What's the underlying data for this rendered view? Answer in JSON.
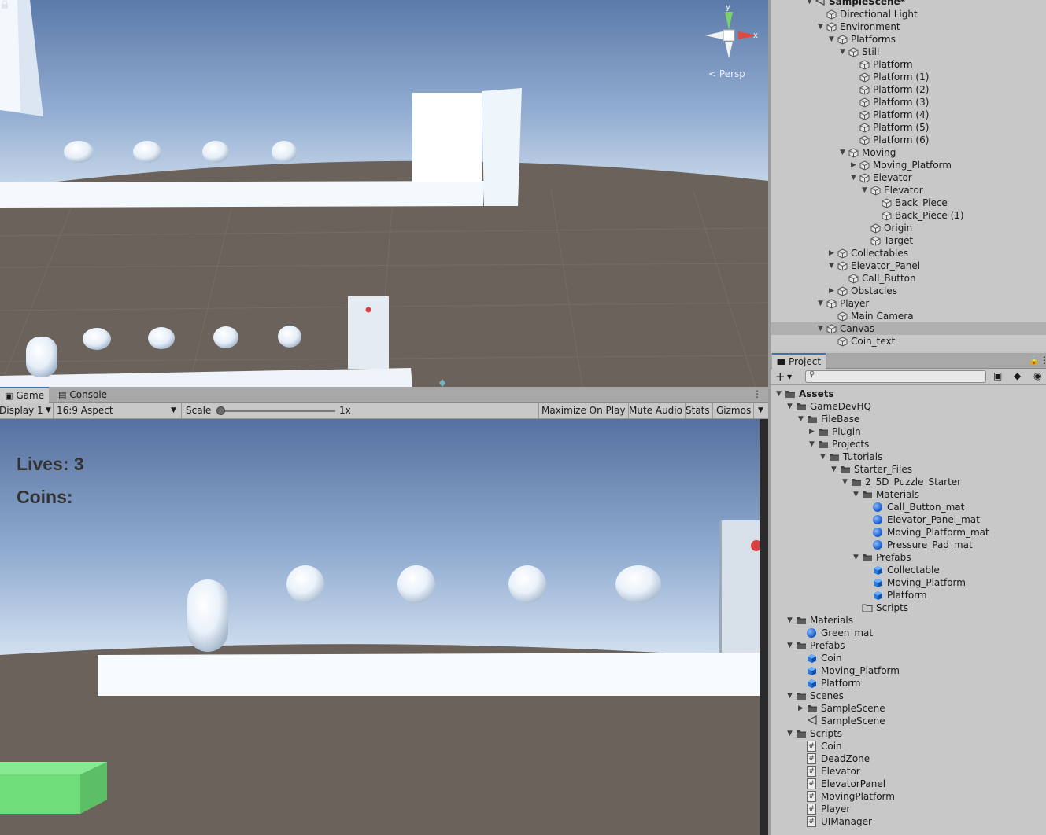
{
  "scene_view": {
    "projection_label": "< Persp",
    "gizmo_axes": {
      "y": "y",
      "x": "x"
    }
  },
  "game_panel": {
    "tabs": [
      {
        "label": "Game",
        "icon": "gamepad-icon",
        "active": true
      },
      {
        "label": "Console",
        "icon": "console-icon",
        "active": false
      }
    ],
    "toolbar": {
      "display": "Display 1",
      "aspect": "16:9 Aspect",
      "scale_label": "Scale",
      "scale_value": "1x",
      "maximize": "Maximize On Play",
      "mute": "Mute Audio",
      "stats": "Stats",
      "gizmos": "Gizmos"
    },
    "hud": {
      "lives": "Lives: 3",
      "coins": "Coins:"
    }
  },
  "hierarchy": {
    "items": [
      {
        "label": "SampleScene*",
        "depth": 2,
        "arrow": "down",
        "type": "scene"
      },
      {
        "label": "Directional Light",
        "depth": 3,
        "arrow": "",
        "type": "object"
      },
      {
        "label": "Environment",
        "depth": 3,
        "arrow": "down",
        "type": "object"
      },
      {
        "label": "Platforms",
        "depth": 4,
        "arrow": "down",
        "type": "object"
      },
      {
        "label": "Still",
        "depth": 5,
        "arrow": "down",
        "type": "object"
      },
      {
        "label": "Platform",
        "depth": 6,
        "arrow": "",
        "type": "object"
      },
      {
        "label": "Platform (1)",
        "depth": 6,
        "arrow": "",
        "type": "object"
      },
      {
        "label": "Platform (2)",
        "depth": 6,
        "arrow": "",
        "type": "object"
      },
      {
        "label": "Platform (3)",
        "depth": 6,
        "arrow": "",
        "type": "object"
      },
      {
        "label": "Platform (4)",
        "depth": 6,
        "arrow": "",
        "type": "object"
      },
      {
        "label": "Platform (5)",
        "depth": 6,
        "arrow": "",
        "type": "object"
      },
      {
        "label": "Platform (6)",
        "depth": 6,
        "arrow": "",
        "type": "object"
      },
      {
        "label": "Moving",
        "depth": 5,
        "arrow": "down",
        "type": "object"
      },
      {
        "label": "Moving_Platform",
        "depth": 6,
        "arrow": "right",
        "type": "object"
      },
      {
        "label": "Elevator",
        "depth": 6,
        "arrow": "down",
        "type": "object"
      },
      {
        "label": "Elevator",
        "depth": 7,
        "arrow": "down",
        "type": "object"
      },
      {
        "label": "Back_Piece",
        "depth": 8,
        "arrow": "",
        "type": "object"
      },
      {
        "label": "Back_Piece (1)",
        "depth": 8,
        "arrow": "",
        "type": "object"
      },
      {
        "label": "Origin",
        "depth": 7,
        "arrow": "",
        "type": "object"
      },
      {
        "label": "Target",
        "depth": 7,
        "arrow": "",
        "type": "object"
      },
      {
        "label": "Collectables",
        "depth": 4,
        "arrow": "right",
        "type": "object"
      },
      {
        "label": "Elevator_Panel",
        "depth": 4,
        "arrow": "down",
        "type": "object"
      },
      {
        "label": "Call_Button",
        "depth": 5,
        "arrow": "",
        "type": "object"
      },
      {
        "label": "Obstacles",
        "depth": 4,
        "arrow": "right",
        "type": "object"
      },
      {
        "label": "Player",
        "depth": 3,
        "arrow": "down",
        "type": "object"
      },
      {
        "label": "Main Camera",
        "depth": 4,
        "arrow": "",
        "type": "object"
      },
      {
        "label": "Canvas",
        "depth": 3,
        "arrow": "down",
        "type": "object",
        "selected": true
      },
      {
        "label": "Coin_text",
        "depth": 4,
        "arrow": "",
        "type": "object"
      }
    ]
  },
  "project": {
    "tab_label": "Project",
    "add_label": "+",
    "tree": [
      {
        "label": "Assets",
        "depth": 0,
        "arrow": "down",
        "type": "folder",
        "bold": true
      },
      {
        "label": "GameDevHQ",
        "depth": 1,
        "arrow": "down",
        "type": "folder"
      },
      {
        "label": "FileBase",
        "depth": 2,
        "arrow": "down",
        "type": "folder"
      },
      {
        "label": "Plugin",
        "depth": 3,
        "arrow": "right",
        "type": "folder"
      },
      {
        "label": "Projects",
        "depth": 3,
        "arrow": "down",
        "type": "folder"
      },
      {
        "label": "Tutorials",
        "depth": 4,
        "arrow": "down",
        "type": "folder"
      },
      {
        "label": "Starter_Files",
        "depth": 5,
        "arrow": "down",
        "type": "folder"
      },
      {
        "label": "2_5D_Puzzle_Starter",
        "depth": 6,
        "arrow": "down",
        "type": "folder"
      },
      {
        "label": "Materials",
        "depth": 7,
        "arrow": "down",
        "type": "folder"
      },
      {
        "label": "Call_Button_mat",
        "depth": 8,
        "arrow": "",
        "type": "material"
      },
      {
        "label": "Elevator_Panel_mat",
        "depth": 8,
        "arrow": "",
        "type": "material"
      },
      {
        "label": "Moving_Platform_mat",
        "depth": 8,
        "arrow": "",
        "type": "material"
      },
      {
        "label": "Pressure_Pad_mat",
        "depth": 8,
        "arrow": "",
        "type": "material"
      },
      {
        "label": "Prefabs",
        "depth": 7,
        "arrow": "down",
        "type": "folder"
      },
      {
        "label": "Collectable",
        "depth": 8,
        "arrow": "",
        "type": "prefab"
      },
      {
        "label": "Moving_Platform",
        "depth": 8,
        "arrow": "",
        "type": "prefab"
      },
      {
        "label": "Platform",
        "depth": 8,
        "arrow": "",
        "type": "prefab"
      },
      {
        "label": "Scripts",
        "depth": 7,
        "arrow": "",
        "type": "folder-empty"
      },
      {
        "label": "Materials",
        "depth": 1,
        "arrow": "down",
        "type": "folder"
      },
      {
        "label": "Green_mat",
        "depth": 2,
        "arrow": "",
        "type": "material"
      },
      {
        "label": "Prefabs",
        "depth": 1,
        "arrow": "down",
        "type": "folder"
      },
      {
        "label": "Coin",
        "depth": 2,
        "arrow": "",
        "type": "prefab"
      },
      {
        "label": "Moving_Platform",
        "depth": 2,
        "arrow": "",
        "type": "prefab"
      },
      {
        "label": "Platform",
        "depth": 2,
        "arrow": "",
        "type": "prefab"
      },
      {
        "label": "Scenes",
        "depth": 1,
        "arrow": "down",
        "type": "folder"
      },
      {
        "label": "SampleScene",
        "depth": 2,
        "arrow": "right",
        "type": "folder"
      },
      {
        "label": "SampleScene",
        "depth": 2,
        "arrow": "",
        "type": "scene"
      },
      {
        "label": "Scripts",
        "depth": 1,
        "arrow": "down",
        "type": "folder"
      },
      {
        "label": "Coin",
        "depth": 2,
        "arrow": "",
        "type": "script"
      },
      {
        "label": "DeadZone",
        "depth": 2,
        "arrow": "",
        "type": "script"
      },
      {
        "label": "Elevator",
        "depth": 2,
        "arrow": "",
        "type": "script"
      },
      {
        "label": "ElevatorPanel",
        "depth": 2,
        "arrow": "",
        "type": "script"
      },
      {
        "label": "MovingPlatform",
        "depth": 2,
        "arrow": "",
        "type": "script"
      },
      {
        "label": "Player",
        "depth": 2,
        "arrow": "",
        "type": "script"
      },
      {
        "label": "UIManager",
        "depth": 2,
        "arrow": "",
        "type": "script"
      }
    ]
  },
  "colors": {
    "accent": "#3a72b0",
    "sky_top": "#5a78a8",
    "ground": "#6b625c",
    "green_block": "#6fdd7a",
    "call_button": "#d94040"
  }
}
